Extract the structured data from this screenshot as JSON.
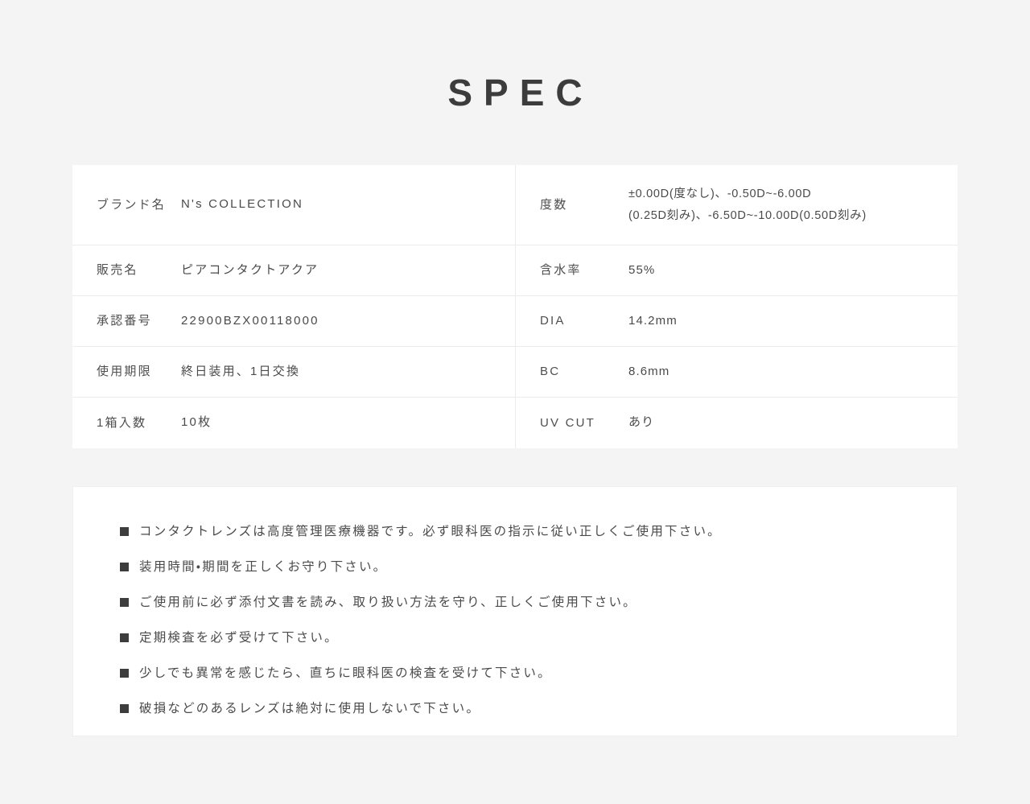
{
  "page": {
    "background_color": "#f4f4f4",
    "card_background_color": "#ffffff",
    "divider_color": "#ececec",
    "text_color": "#4a4a4a",
    "title": "SPEC"
  },
  "spec_table": {
    "left_column": [
      {
        "label": "ブランド名",
        "value": "N's COLLECTION"
      },
      {
        "label": "販売名",
        "value": "ピアコンタクトアクア"
      },
      {
        "label": "承認番号",
        "value": "22900BZX00118000"
      },
      {
        "label": "使用期限",
        "value": "終日装用、1日交換"
      },
      {
        "label": "1箱入数",
        "value": "10枚"
      }
    ],
    "right_column": [
      {
        "label": "度数",
        "value_line1": "±0.00D(度なし)、-0.50D~-6.00D",
        "value_line2": "(0.25D刻み)、-6.50D~-10.00D(0.50D刻み)"
      },
      {
        "label": "含水率",
        "value": "55%"
      },
      {
        "label": "DIA",
        "value": "14.2mm"
      },
      {
        "label": "BC",
        "value": "8.6mm"
      },
      {
        "label": "UV CUT",
        "value": "あり"
      }
    ]
  },
  "notices": {
    "bullet_color": "#3d3d3d",
    "items": [
      "コンタクトレンズは高度管理医療機器です。必ず眼科医の指示に従い正しくご使用下さい。",
      "装用時間・期間を正しくお守り下さい。",
      "ご使用前に必ず添付文書を読み、取り扱い方法を守り、正しくご使用下さい。",
      "定期検査を必ず受けて下さい。",
      "少しでも異常を感じたら、直ちに眼科医の検査を受けて下さい。",
      "破損などのあるレンズは絶対に使用しないで下さい。"
    ]
  }
}
